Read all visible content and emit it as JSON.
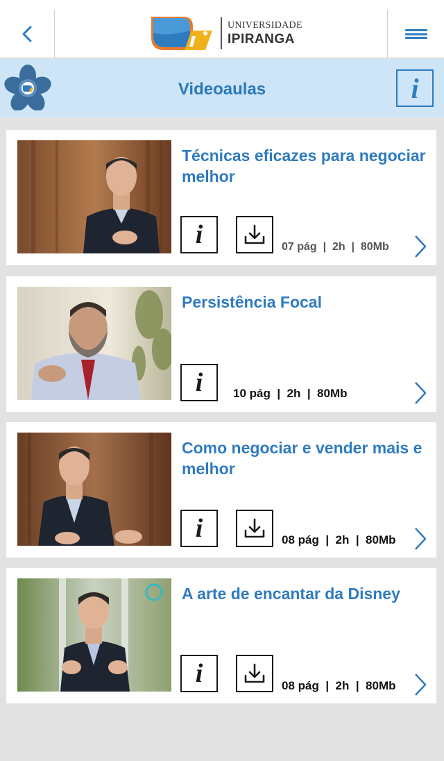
{
  "header": {
    "logo_top": "UNIVERSIDADE",
    "logo_bottom": "IPIRANGA"
  },
  "section": {
    "title": "Videoaulas",
    "info_label": "i"
  },
  "icons": {
    "back": "chevron-left-icon",
    "menu": "hamburger-icon",
    "info": "info-icon",
    "download": "download-icon",
    "next": "chevron-right-icon"
  },
  "colors": {
    "accent": "#2f7bc0",
    "header_bg": "#cde5f7",
    "page_bg": "#e2e2e2"
  },
  "cards": [
    {
      "title": "Técnicas eficazes para negociar melhor",
      "info_label": "i",
      "pages": "07 pág",
      "duration": "2h",
      "size": "80Mb",
      "sep": "|",
      "has_download": true
    },
    {
      "title": "Persistência Focal",
      "info_label": "i",
      "pages": "10 pág",
      "duration": "2h",
      "size": "80Mb",
      "sep": "|",
      "has_download": false
    },
    {
      "title": "Como negociar e vender mais e melhor",
      "info_label": "i",
      "pages": "08 pág",
      "duration": "2h",
      "size": "80Mb",
      "sep": "|",
      "has_download": true
    },
    {
      "title": "A arte de encantar da Disney",
      "info_label": "i",
      "pages": "08 pág",
      "duration": "2h",
      "size": "80Mb",
      "sep": "|",
      "has_download": true
    }
  ]
}
